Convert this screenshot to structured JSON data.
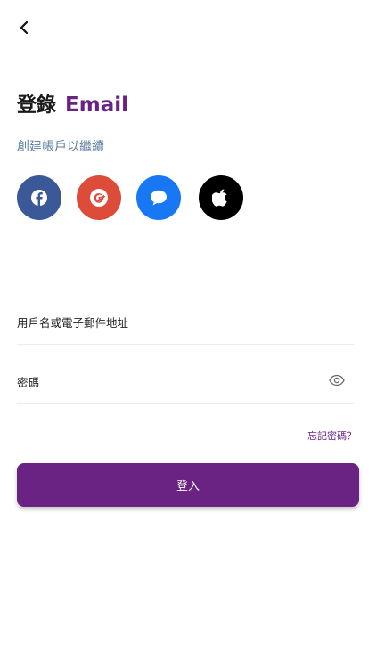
{
  "header": {
    "back_icon": "chevron-left-icon"
  },
  "title": {
    "main": "登錄",
    "accent": "Email"
  },
  "subtitle": "創建帳戶以繼續",
  "social": [
    {
      "name": "facebook",
      "icon": "facebook-icon",
      "color": "#3b5998"
    },
    {
      "name": "google-plus",
      "icon": "google-plus-icon",
      "color": "#dd4b39"
    },
    {
      "name": "message",
      "icon": "chat-bubble-icon",
      "color": "#1877f2"
    },
    {
      "name": "apple",
      "icon": "apple-icon",
      "color": "#000000"
    }
  ],
  "form": {
    "username_label": "用戶名或電子郵件地址",
    "password_label": "密碼",
    "password_toggle_icon": "eye-icon"
  },
  "forgot_password": "忘記密碼？",
  "login_button": "登入",
  "colors": {
    "accent": "#6a2283",
    "subtitle": "#5b7ea0"
  }
}
